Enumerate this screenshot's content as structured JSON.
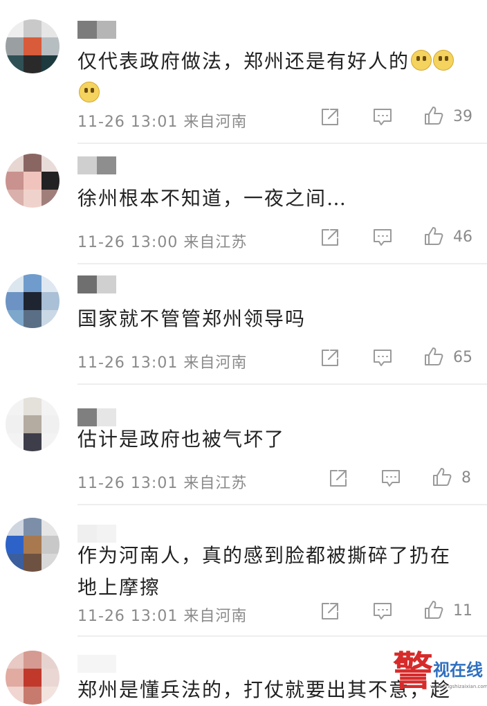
{
  "comments": [
    {
      "text": "仅代表政府做法，郑州还是有好人的",
      "time": "11-26 13:01 来自河南",
      "likes": "39",
      "avatar_colors": [
        "#eeeeee",
        "#c9c9c9",
        "#e6e6e6",
        "#9aa0a2",
        "#d85b3a",
        "#b7bec1",
        "#2f5155",
        "#2a2a2a",
        "#1d3a3f"
      ],
      "username_colors": [
        "#7c7c7c",
        "#b5b5b5"
      ]
    },
    {
      "text": "徐州根本不知道，一夜之间…",
      "time": "11-26 13:00 来自江苏",
      "likes": "46",
      "avatar_colors": [
        "#e7d6d2",
        "#8a6663",
        "#e8dcd9",
        "#c9928e",
        "#f0c4bc",
        "#222222",
        "#d9b0ab",
        "#f0d2cc",
        "#a07f7b"
      ],
      "username_colors": [
        "#cfcfcf",
        "#8e8e8e"
      ]
    },
    {
      "text": "国家就不管管郑州领导吗",
      "time": "11-26 13:01 来自河南",
      "likes": "65",
      "avatar_colors": [
        "#dbe6ef",
        "#6f9ccc",
        "#dfe8f1",
        "#6c93c4",
        "#1e2430",
        "#a9c0d6",
        "#7ea7cc",
        "#5a6f86",
        "#cad8e6"
      ],
      "username_colors": [
        "#6f6f6f",
        "#d0d0d0"
      ]
    },
    {
      "text": "估计是政府也被气坏了",
      "time": "11-26 13:01 来自江苏",
      "likes": "8",
      "avatar_colors": [
        "#f3f3f3",
        "#e4e0da",
        "#f3f3f3",
        "#f0f0f0",
        "#b4aba1",
        "#f0f0f0",
        "#f3f3f3",
        "#3e3d4a",
        "#f3f3f3"
      ],
      "username_colors": [
        "#7f7f7f",
        "#e6e6e6"
      ]
    },
    {
      "text": "作为河南人，真的感到脸都被撕碎了扔在地上摩擦",
      "time": "11-26 13:01 来自河南",
      "likes": "11",
      "avatar_colors": [
        "#cfd6e0",
        "#7d8fa8",
        "#e5e5e5",
        "#2d63c8",
        "#a8794f",
        "#c8c8c8",
        "#3b5e9e",
        "#6e5241",
        "#d8d8d8"
      ],
      "username_colors": [
        "#efefef",
        "#f3f3f3"
      ]
    },
    {
      "text": "郑州是懂兵法的，打仗就要出其不意，趁",
      "avatar_colors": [
        "#e8c9c3",
        "#d59a91",
        "#e6d3cf",
        "#e1aba2",
        "#c0392b",
        "#ead7d3",
        "#f0d5d0",
        "#c77b6f",
        "#f3e3df"
      ],
      "username_colors": [
        "#f5f5f5",
        "#f5f5f5"
      ]
    }
  ],
  "watermark": {
    "glyph": "警",
    "brand": "视在线",
    "url": "www.jingshizaixian.com"
  },
  "colors": {
    "meta": "#8a8a8a",
    "icon": "#9a9a9a",
    "divider": "#eeeeee",
    "watermark_red": "#d62b2b",
    "watermark_blue": "#2f6fc0"
  },
  "icons": [
    "repost-icon",
    "comment-icon",
    "like-icon"
  ]
}
